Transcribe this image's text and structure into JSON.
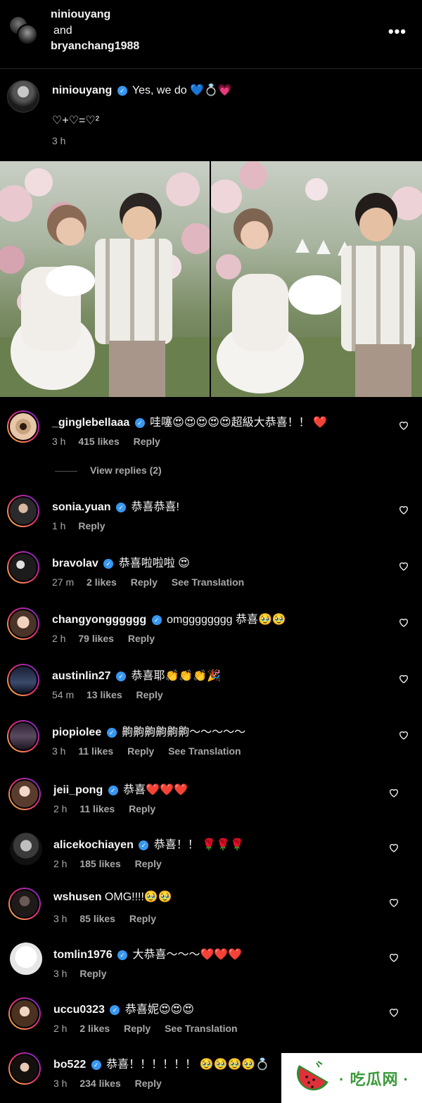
{
  "header": {
    "user1": "niniouyang",
    "and": "and",
    "user2": "bryanchang1988",
    "more_icon": "more-horizontal-icon"
  },
  "caption": {
    "username": "niniouyang",
    "text": "Yes, we do 💙💍💗",
    "body": "♡+♡=♡²",
    "time": "3 h"
  },
  "comments": [
    {
      "username": "_ginglebellaaa",
      "verified": true,
      "text": "哇噻😍😍😍😍😍超級大恭喜！！ ❤️",
      "time": "3 h",
      "likes": "415 likes",
      "reply": "Reply",
      "view_replies": "View replies (2)"
    },
    {
      "username": "sonia.yuan",
      "verified": true,
      "text": "恭喜恭喜!",
      "time": "1 h",
      "reply": "Reply"
    },
    {
      "username": "bravolav",
      "verified": true,
      "text": "恭喜啦啦啦 😍",
      "time": "27 m",
      "likes": "2 likes",
      "reply": "Reply",
      "translation": "See Translation"
    },
    {
      "username": "changyongggggg",
      "verified": true,
      "text": "omgggggggg 恭喜🥹🥹",
      "time": "2 h",
      "likes": "79 likes",
      "reply": "Reply"
    },
    {
      "username": "austinlin27",
      "verified": true,
      "text": "恭喜耶👏👏👏🎉",
      "time": "54 m",
      "likes": "13 likes",
      "reply": "Reply"
    },
    {
      "username": "piopiolee",
      "verified": true,
      "text": "齁齁齁齁齁齁～～～～～",
      "time": "3 h",
      "likes": "11 likes",
      "reply": "Reply",
      "translation": "See Translation"
    },
    {
      "username": "jeii_pong",
      "verified": true,
      "text": "恭喜❤️❤️❤️",
      "time": "2 h",
      "likes": "11 likes",
      "reply": "Reply"
    },
    {
      "username": "alicekochiayen",
      "verified": true,
      "text": "恭喜！！ 🌹🌹🌹",
      "time": "2 h",
      "likes": "185 likes",
      "reply": "Reply"
    },
    {
      "username": "wshusen",
      "verified": false,
      "text": "OMG!!!!🥹🥹",
      "time": "3 h",
      "likes": "85 likes",
      "reply": "Reply"
    },
    {
      "username": "tomlin1976",
      "verified": true,
      "text": "大恭喜～～～❤️❤️❤️",
      "time": "3 h",
      "reply": "Reply"
    },
    {
      "username": "uccu0323",
      "verified": true,
      "text": "恭喜妮😍😍😍",
      "time": "2 h",
      "likes": "2 likes",
      "reply": "Reply",
      "translation": "See Translation"
    },
    {
      "username": "bo522",
      "verified": true,
      "text": "恭喜！！！！！！ 🥹🥹🥹🥹💍",
      "time": "3 h",
      "likes": "234 likes",
      "reply": "Reply"
    }
  ],
  "watermark": {
    "text": "· 吃瓜网 ·"
  }
}
